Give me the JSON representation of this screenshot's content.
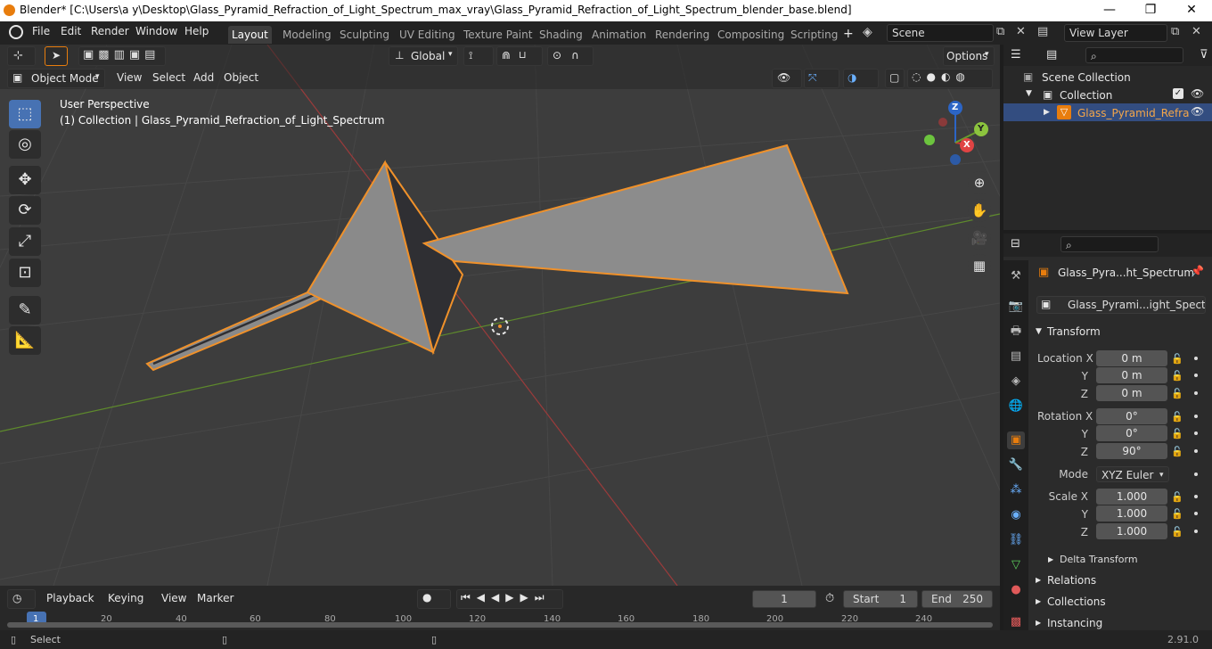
{
  "window": {
    "title": "Blender* [C:\\Users\\a y\\Desktop\\Glass_Pyramid_Refraction_of_Light_Spectrum_max_vray\\Glass_Pyramid_Refraction_of_Light_Spectrum_blender_base.blend]",
    "minimize": "—",
    "maximize": "❐",
    "close": "✕"
  },
  "menu": [
    "File",
    "Edit",
    "Render",
    "Window",
    "Help"
  ],
  "workspaces": [
    "Layout",
    "Modeling",
    "Sculpting",
    "UV Editing",
    "Texture Paint",
    "Shading",
    "Animation",
    "Rendering",
    "Compositing",
    "Scripting"
  ],
  "workspace_add": "+",
  "scene": {
    "label": "Scene"
  },
  "view_layer": {
    "label": "View Layer"
  },
  "viewport": {
    "transform_orientation": "Global",
    "options": "Options",
    "mode": "Object Mode",
    "header_menus": [
      "View",
      "Select",
      "Add",
      "Object"
    ],
    "overlay_title": "User Perspective",
    "overlay_subtitle": "(1) Collection | Glass_Pyramid_Refraction_of_Light_Spectrum",
    "gizmo": {
      "x": "X",
      "y": "Y",
      "z": "Z"
    },
    "colors": {
      "bg": "#3d3d3d",
      "grid": "#474747",
      "x_axis": "#9b3b3b",
      "y_axis": "#5e8a2c",
      "selection": "#f0912a",
      "mesh": "#8a8a8a",
      "mesh_dark": "#2f2f33"
    }
  },
  "outliner": {
    "scene_collection": "Scene Collection",
    "collection": "Collection",
    "object": "Glass_Pyramid_Refra"
  },
  "properties": {
    "object_name": "Glass_Pyra...ht_Spectrum",
    "data_name": "Glass_Pyrami...ight_Spectrum",
    "transform_header": "Transform",
    "location": {
      "label_x": "Location X",
      "label_y": "Y",
      "label_z": "Z",
      "x": "0 m",
      "y": "0 m",
      "z": "0 m"
    },
    "rotation": {
      "label_x": "Rotation X",
      "label_y": "Y",
      "label_z": "Z",
      "x": "0°",
      "y": "0°",
      "z": "90°"
    },
    "mode": {
      "label": "Mode",
      "value": "XYZ Euler"
    },
    "scale": {
      "label_x": "Scale X",
      "label_y": "Y",
      "label_z": "Z",
      "x": "1.000",
      "y": "1.000",
      "z": "1.000"
    },
    "delta_transform": "Delta Transform",
    "relations": "Relations",
    "collections": "Collections",
    "instancing": "Instancing"
  },
  "timeline": {
    "menus": [
      "Playback",
      "Keying",
      "View",
      "Marker"
    ],
    "current_frame": "1",
    "start_label": "Start",
    "start": "1",
    "end_label": "End",
    "end": "250",
    "ticks": [
      "1",
      "20",
      "40",
      "60",
      "80",
      "100",
      "120",
      "140",
      "160",
      "180",
      "200",
      "220",
      "240"
    ]
  },
  "status": {
    "select": "Select",
    "version": "2.91.0"
  }
}
